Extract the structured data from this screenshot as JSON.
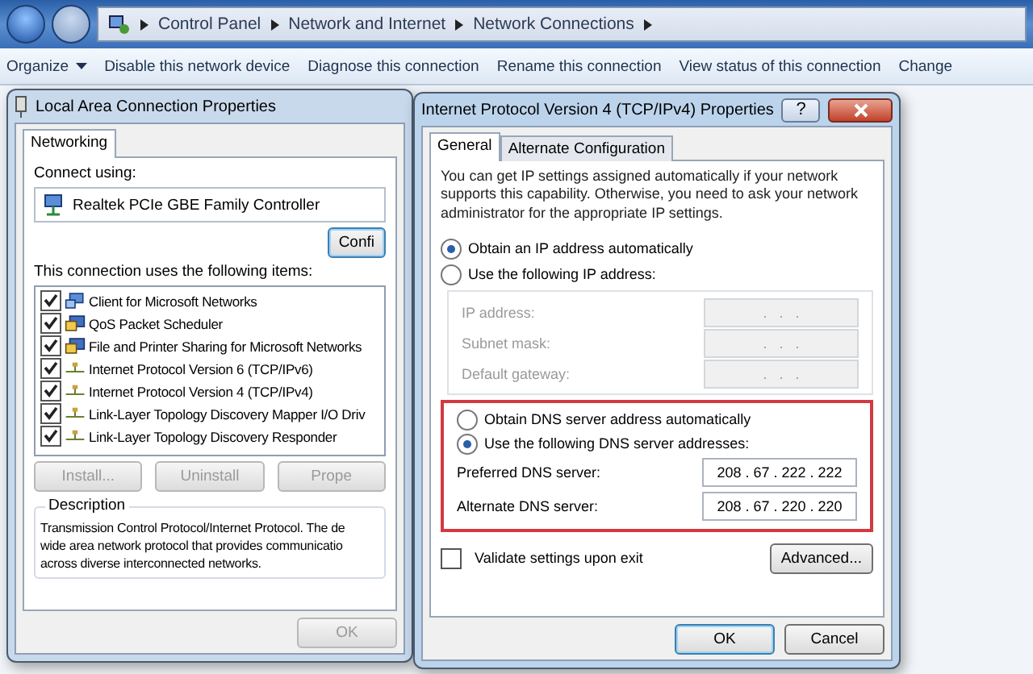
{
  "address_bar": {
    "breadcrumbs": [
      "Control Panel",
      "Network and Internet",
      "Network Connections"
    ]
  },
  "toolbar": {
    "items": [
      {
        "label": "Organize",
        "kind": "menu"
      },
      {
        "label": "Disable this network device",
        "kind": "action"
      },
      {
        "label": "Diagnose this connection",
        "kind": "action"
      },
      {
        "label": "Rename this connection",
        "kind": "action"
      },
      {
        "label": "View status of this connection",
        "kind": "action"
      },
      {
        "label": "Change",
        "kind": "action"
      }
    ]
  },
  "connection_dialog": {
    "title": "Local Area Connection Properties",
    "tabs": [
      {
        "label": "Networking",
        "selected": true
      }
    ],
    "connect_using_label": "Connect using:",
    "adapter": "Realtek PCIe GBE Family Controller",
    "configure_button": "Confi",
    "items_label": "This connection uses the following items:",
    "items": [
      {
        "label": "Client for Microsoft Networks",
        "kind": "client",
        "checked": true
      },
      {
        "label": "QoS Packet Scheduler",
        "kind": "service",
        "checked": true
      },
      {
        "label": "File and Printer Sharing for Microsoft Networks",
        "kind": "service",
        "checked": true
      },
      {
        "label": "Internet Protocol Version 6 (TCP/IPv6)",
        "kind": "protocol",
        "checked": true
      },
      {
        "label": "Internet Protocol Version 4 (TCP/IPv4)",
        "kind": "protocol",
        "checked": true
      },
      {
        "label": "Link-Layer Topology Discovery Mapper I/O Driv",
        "kind": "protocol",
        "checked": true
      },
      {
        "label": "Link-Layer Topology Discovery Responder",
        "kind": "protocol",
        "checked": true
      }
    ],
    "buttons": [
      {
        "label": "Install...",
        "disabled": true
      },
      {
        "label": "Uninstall",
        "disabled": true
      },
      {
        "label": "Prope",
        "disabled": true
      }
    ],
    "description": {
      "title": "Description",
      "lines": [
        "Transmission Control Protocol/Internet Protocol. The de",
        "wide area network protocol that provides communicatio",
        "across diverse interconnected networks."
      ]
    },
    "footer_buttons": [
      {
        "label": "OK",
        "disabled": true
      }
    ]
  },
  "ipv4_dialog": {
    "title": "Internet Protocol Version 4 (TCP/IPv4) Properties",
    "help_button": "?",
    "tabs": [
      {
        "label": "General",
        "selected": true
      },
      {
        "label": "Alternate Configuration",
        "selected": false
      }
    ],
    "intro": "You can get IP settings assigned automatically if your network supports this capability. Otherwise, you need to ask your network administrator for the appropriate IP settings.",
    "ip_mode": [
      {
        "label": "Obtain an IP address automatically",
        "selected": true
      },
      {
        "label": "Use the following IP address:",
        "selected": false
      }
    ],
    "ip_fields": [
      {
        "label": "IP address:",
        "value": ".   .   .",
        "disabled": true
      },
      {
        "label": "Subnet mask:",
        "value": ".   .   .",
        "disabled": true
      },
      {
        "label": "Default gateway:",
        "value": ".   .   .",
        "disabled": true
      }
    ],
    "dns_mode": [
      {
        "label": "Obtain DNS server address automatically",
        "selected": false
      },
      {
        "label": "Use the following DNS server addresses:",
        "selected": true
      }
    ],
    "dns_fields": [
      {
        "label": "Preferred DNS server:",
        "value": "208 . 67 . 222 . 222",
        "disabled": false
      },
      {
        "label": "Alternate DNS server:",
        "value": "208 . 67 . 220 . 220",
        "disabled": false
      }
    ],
    "validate": {
      "label": "Validate settings upon exit",
      "checked": false
    },
    "advanced_button": "Advanced...",
    "footer_buttons": [
      {
        "label": "OK",
        "default": true
      },
      {
        "label": "Cancel",
        "default": false
      }
    ]
  }
}
